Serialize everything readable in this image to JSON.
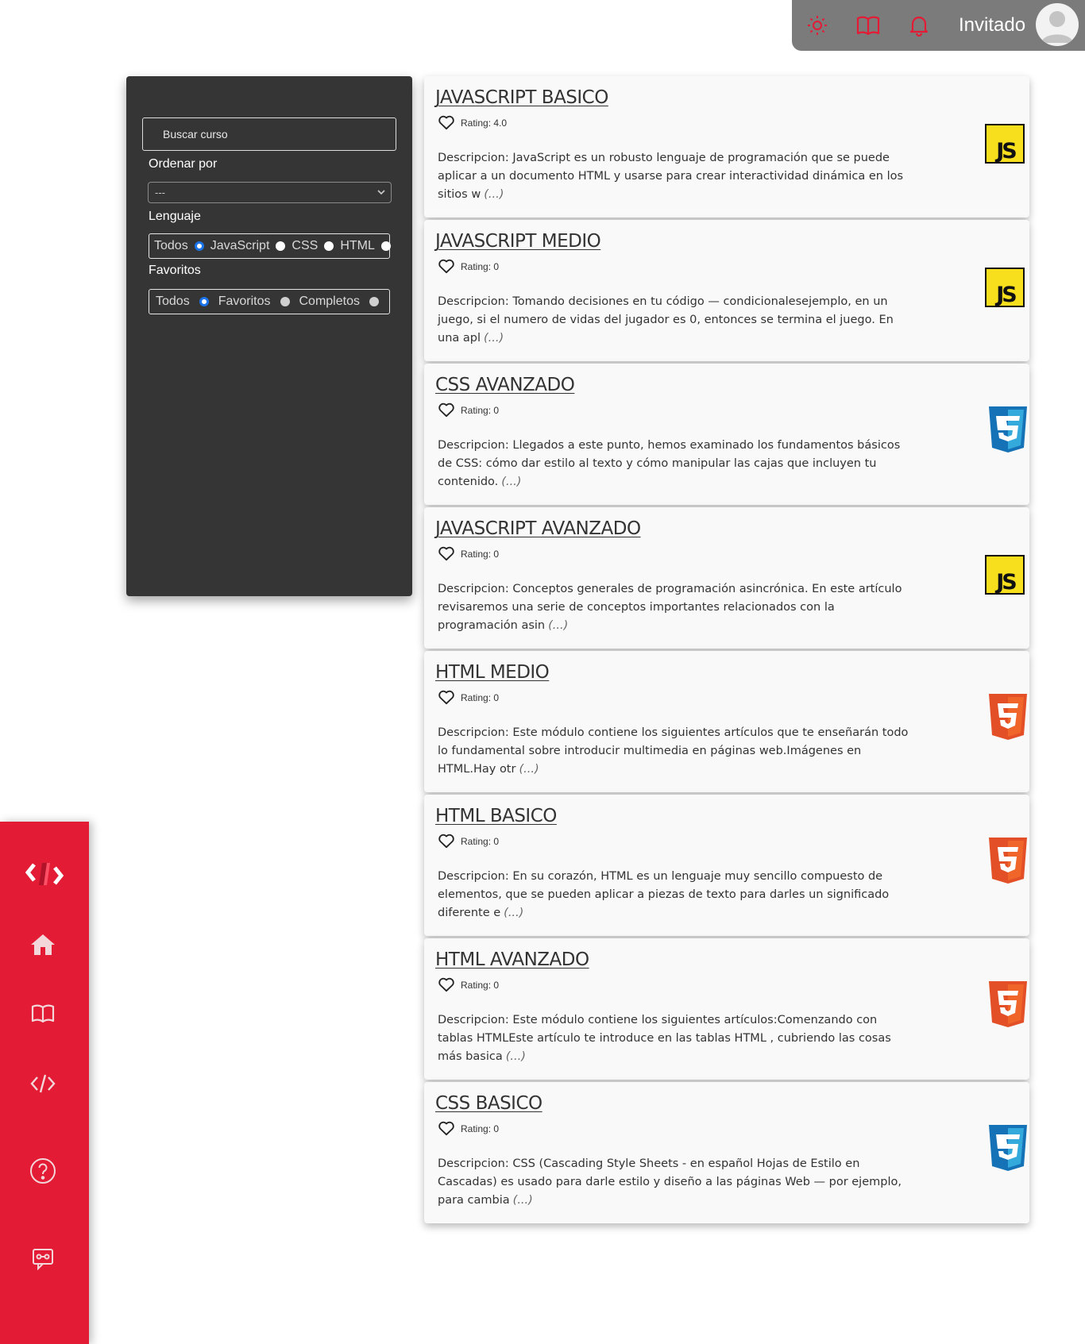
{
  "topbar": {
    "icons": [
      "sun-icon",
      "book-icon",
      "bell-icon"
    ],
    "user_name": "Invitado",
    "accent": "#e31b35"
  },
  "filters": {
    "search_placeholder": "Buscar curso",
    "sort_label": "Ordenar por",
    "sort_value": "---",
    "language_label": "Lenguaje",
    "language_options": [
      "Todos",
      "JavaScript",
      "CSS",
      "HTML"
    ],
    "language_selected": "Todos",
    "favorites_label": "Favoritos",
    "favorites_options": [
      "Todos",
      "Favoritos",
      "Completos"
    ],
    "favorites_selected": "Todos"
  },
  "sidenav": {
    "items": [
      "logo-icon",
      "home-icon",
      "book-icon",
      "code-icon",
      "help-icon",
      "chat-icon"
    ],
    "color": "#e31b35"
  },
  "courses": [
    {
      "title": "JAVASCRIPT BASICO",
      "rating": "Rating: 4.0",
      "desc": "Descripcion: JavaScript es un robusto lenguaje de programación que se puede aplicar a un documento HTML y usarse para crear interactividad dinámica en los sitios w",
      "more": "(...)",
      "lang": "js"
    },
    {
      "title": "JAVASCRIPT MEDIO",
      "rating": "Rating: 0",
      "desc": "Descripcion: Tomando decisiones en tu código — condicionalesejemplo, en un juego, si el numero de vidas del jugador es 0, entonces se termina el juego. En una apl",
      "more": "(...)",
      "lang": "js"
    },
    {
      "title": "CSS AVANZADO",
      "rating": "Rating: 0",
      "desc": "Descripcion: Llegados a este punto, hemos examinado los fundamentos básicos de CSS: cómo dar estilo al texto y cómo manipular las cajas que incluyen tu contenido.",
      "more": "(...)",
      "lang": "css"
    },
    {
      "title": "JAVASCRIPT AVANZADO",
      "rating": "Rating: 0",
      "desc": "Descripcion: Conceptos generales de programación asincrónica. En este artículo revisaremos una serie de conceptos importantes relacionados con la programación asin",
      "more": "(...)",
      "lang": "js"
    },
    {
      "title": "HTML MEDIO",
      "rating": "Rating: 0",
      "desc": "Descripcion: Este módulo contiene los siguientes artículos que te enseñarán todo lo fundamental sobre introducir multimedia en páginas web.Imágenes en HTML.Hay otr",
      "more": "(...)",
      "lang": "html"
    },
    {
      "title": "HTML BASICO",
      "rating": "Rating: 0",
      "desc": "Descripcion: En su corazón, HTML es un lenguaje muy sencillo compuesto de elementos, que se pueden aplicar a piezas de texto para darles un significado diferente e",
      "more": "(...)",
      "lang": "html"
    },
    {
      "title": "HTML AVANZADO",
      "rating": "Rating: 0",
      "desc": "Descripcion: Este módulo contiene los siguientes artículos:Comenzando con tablas HTMLEste artículo te introduce en las tablas HTML , cubriendo las cosas más basica",
      "more": "(...)",
      "lang": "html"
    },
    {
      "title": "CSS BASICO",
      "rating": "Rating: 0",
      "desc": "Descripcion: CSS (Cascading Style Sheets - en español Hojas de Estilo en Cascadas) es usado para darle estilo y diseño a las páginas Web — por ejemplo, para cambia",
      "more": "(...)",
      "lang": "css"
    }
  ]
}
